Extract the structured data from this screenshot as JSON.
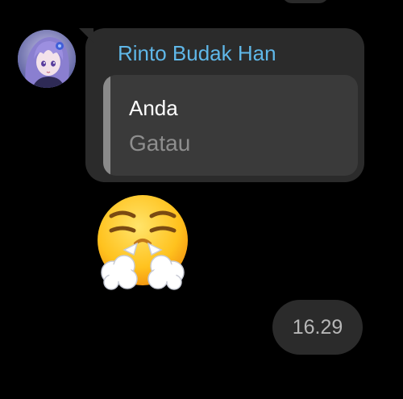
{
  "message": {
    "sender_name": "Rinto Budak Han",
    "sender_color": "#5fb7e8",
    "avatar_icon": "anime-avatar",
    "reply": {
      "author": "Anda",
      "text": "Gatau"
    }
  },
  "sticker": {
    "icon": "face-with-steam-from-nose-emoji"
  },
  "timestamp": {
    "time": "16.29"
  }
}
